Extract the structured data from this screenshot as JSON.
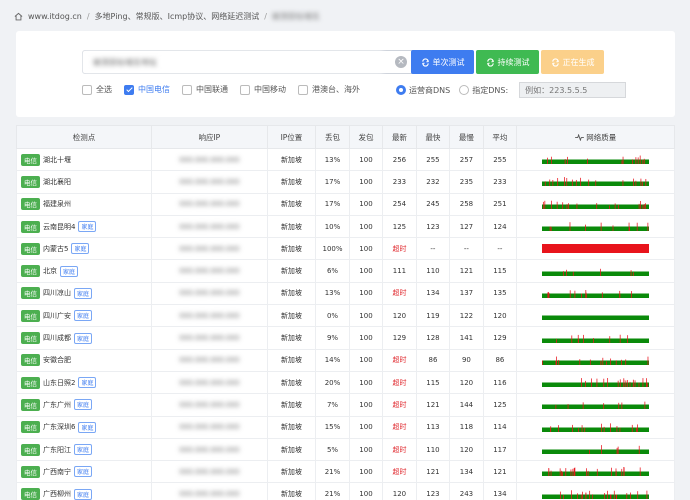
{
  "breadcrumb": {
    "site": "www.itdog.cn",
    "page": "多地Ping、常规版、Icmp协议、网络延迟测试",
    "target": "被测目标域名"
  },
  "search": {
    "value": "被测目标域名地址",
    "clear_icon": "close-circle-icon"
  },
  "buttons": {
    "single": "单次测试",
    "continuous": "持续测试",
    "generating": "正在生成"
  },
  "filters": [
    {
      "label": "全选",
      "checked": false
    },
    {
      "label": "中国电信",
      "checked": true
    },
    {
      "label": "中国联通",
      "checked": false
    },
    {
      "label": "中国移动",
      "checked": false
    },
    {
      "label": "港澳台、海外",
      "checked": false
    }
  ],
  "dns": {
    "isp_label": "运营商DNS",
    "custom_label": "指定DNS:",
    "placeholder": "例如：223.5.5.5",
    "selected": "isp"
  },
  "table": {
    "headers": [
      "检测点",
      "响应IP",
      "IP位置",
      "丢包",
      "发包",
      "最新",
      "最快",
      "最慢",
      "平均",
      "网络质量"
    ],
    "quality_icon": "pulse-icon",
    "rows": [
      {
        "isp": "电信",
        "loc": "湖北十堰",
        "home": "",
        "ip": "000.000.000.000",
        "geo": "新加坡",
        "loss": "13%",
        "sent": "100",
        "latest": "256",
        "fast": "255",
        "slow": "257",
        "avg": "255",
        "quality": 0.13
      },
      {
        "isp": "电信",
        "loc": "湖北襄阳",
        "home": "",
        "ip": "000.000.000.000",
        "geo": "新加坡",
        "loss": "17%",
        "sent": "100",
        "latest": "233",
        "fast": "232",
        "slow": "235",
        "avg": "233",
        "quality": 0.17
      },
      {
        "isp": "电信",
        "loc": "福建泉州",
        "home": "",
        "ip": "000.000.000.000",
        "geo": "新加坡",
        "loss": "17%",
        "sent": "100",
        "latest": "254",
        "fast": "245",
        "slow": "258",
        "avg": "251",
        "quality": 0.17
      },
      {
        "isp": "电信",
        "loc": "云南昆明4",
        "home": "家庭",
        "ip": "000.000.000.000",
        "geo": "新加坡",
        "loss": "10%",
        "sent": "100",
        "latest": "125",
        "fast": "123",
        "slow": "127",
        "avg": "124",
        "quality": 0.1
      },
      {
        "isp": "电信",
        "loc": "内蒙古5",
        "home": "家庭",
        "ip": "000.000.000.000",
        "geo": "新加坡",
        "loss": "100%",
        "sent": "100",
        "latest": "超时",
        "fast": "--",
        "slow": "--",
        "avg": "--",
        "quality": 1.0
      },
      {
        "isp": "电信",
        "loc": "北京",
        "home": "家庭",
        "ip": "000.000.000.000",
        "geo": "新加坡",
        "loss": "6%",
        "sent": "100",
        "latest": "111",
        "fast": "110",
        "slow": "121",
        "avg": "115",
        "quality": 0.06
      },
      {
        "isp": "电信",
        "loc": "四川凉山",
        "home": "家庭",
        "ip": "000.000.000.000",
        "geo": "新加坡",
        "loss": "13%",
        "sent": "100",
        "latest": "超时",
        "fast": "134",
        "slow": "137",
        "avg": "135",
        "quality": 0.13
      },
      {
        "isp": "电信",
        "loc": "四川广安",
        "home": "家庭",
        "ip": "000.000.000.000",
        "geo": "新加坡",
        "loss": "0%",
        "sent": "100",
        "latest": "120",
        "fast": "119",
        "slow": "122",
        "avg": "120",
        "quality": 0.0
      },
      {
        "isp": "电信",
        "loc": "四川成都",
        "home": "家庭",
        "ip": "000.000.000.000",
        "geo": "新加坡",
        "loss": "9%",
        "sent": "100",
        "latest": "129",
        "fast": "128",
        "slow": "141",
        "avg": "129",
        "quality": 0.09
      },
      {
        "isp": "电信",
        "loc": "安徽合肥",
        "home": "",
        "ip": "000.000.000.000",
        "geo": "新加坡",
        "loss": "14%",
        "sent": "100",
        "latest": "超时",
        "fast": "86",
        "slow": "90",
        "avg": "86",
        "quality": 0.14
      },
      {
        "isp": "电信",
        "loc": "山东日照2",
        "home": "家庭",
        "ip": "000.000.000.000",
        "geo": "新加坡",
        "loss": "20%",
        "sent": "100",
        "latest": "超时",
        "fast": "115",
        "slow": "120",
        "avg": "116",
        "quality": 0.2
      },
      {
        "isp": "电信",
        "loc": "广东广州",
        "home": "家庭",
        "ip": "000.000.000.000",
        "geo": "新加坡",
        "loss": "7%",
        "sent": "100",
        "latest": "超时",
        "fast": "121",
        "slow": "144",
        "avg": "125",
        "quality": 0.07
      },
      {
        "isp": "电信",
        "loc": "广东深圳6",
        "home": "家庭",
        "ip": "000.000.000.000",
        "geo": "新加坡",
        "loss": "15%",
        "sent": "100",
        "latest": "超时",
        "fast": "113",
        "slow": "118",
        "avg": "114",
        "quality": 0.15
      },
      {
        "isp": "电信",
        "loc": "广东阳江",
        "home": "家庭",
        "ip": "000.000.000.000",
        "geo": "新加坡",
        "loss": "5%",
        "sent": "100",
        "latest": "超时",
        "fast": "110",
        "slow": "120",
        "avg": "117",
        "quality": 0.05
      },
      {
        "isp": "电信",
        "loc": "广西南宁",
        "home": "家庭",
        "ip": "000.000.000.000",
        "geo": "新加坡",
        "loss": "21%",
        "sent": "100",
        "latest": "超时",
        "fast": "121",
        "slow": "134",
        "avg": "121",
        "quality": 0.21
      },
      {
        "isp": "电信",
        "loc": "广西柳州",
        "home": "家庭",
        "ip": "000.000.000.000",
        "geo": "新加坡",
        "loss": "21%",
        "sent": "100",
        "latest": "120",
        "fast": "123",
        "slow": "243",
        "avg": "134",
        "quality": 0.21
      }
    ]
  },
  "colors": {
    "primary": "#3e7cf0",
    "success": "#3fba52",
    "warning": "#fbd08a",
    "good": "#0a8a0a",
    "bad": "#e8141c"
  }
}
